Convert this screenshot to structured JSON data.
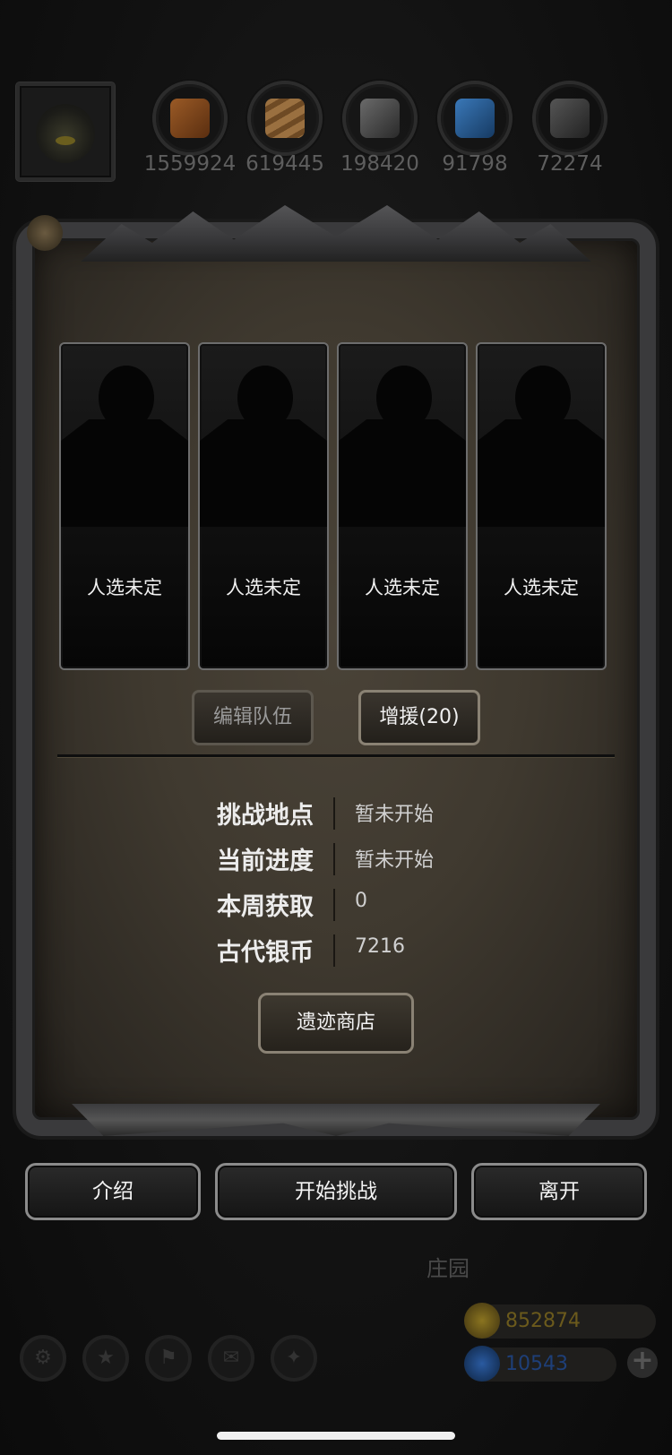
{
  "resources": [
    {
      "icon": "meat-resource-icon",
      "value": "1559924",
      "color": "#8a4a1c"
    },
    {
      "icon": "wood-resource-icon",
      "value": "619445",
      "color": "#8a6438"
    },
    {
      "icon": "iron-resource-icon",
      "value": "198420",
      "color": "#4a4a4a"
    },
    {
      "icon": "crystal-resource-icon",
      "value": "91798",
      "color": "#2a5a8a"
    },
    {
      "icon": "stone-resource-icon",
      "value": "72274",
      "color": "#3a3a3a"
    }
  ],
  "slots": [
    {
      "label": "人选未定"
    },
    {
      "label": "人选未定"
    },
    {
      "label": "人选未定"
    },
    {
      "label": "人选未定"
    }
  ],
  "team": {
    "edit_label": "编辑队伍",
    "reinforce_label": "增援(20)"
  },
  "info": [
    {
      "label": "挑战地点",
      "value": "暂未开始"
    },
    {
      "label": "当前进度",
      "value": "暂未开始"
    },
    {
      "label": "本周获取",
      "value": "0"
    },
    {
      "label": "古代银币",
      "value": "7216"
    }
  ],
  "shop_label": "遗迹商店",
  "actions": {
    "intro": "介绍",
    "start": "开始挑战",
    "leave": "离开"
  },
  "background": {
    "location_label": "庄园"
  },
  "currency": {
    "gold": "852874",
    "gems": "10543",
    "gold_color": "#6b5a1c",
    "gem_color": "#1e3f78"
  },
  "bottom_icons": [
    "settings-icon",
    "achievement-icon",
    "guild-icon",
    "mail-icon",
    "handshake-icon"
  ]
}
